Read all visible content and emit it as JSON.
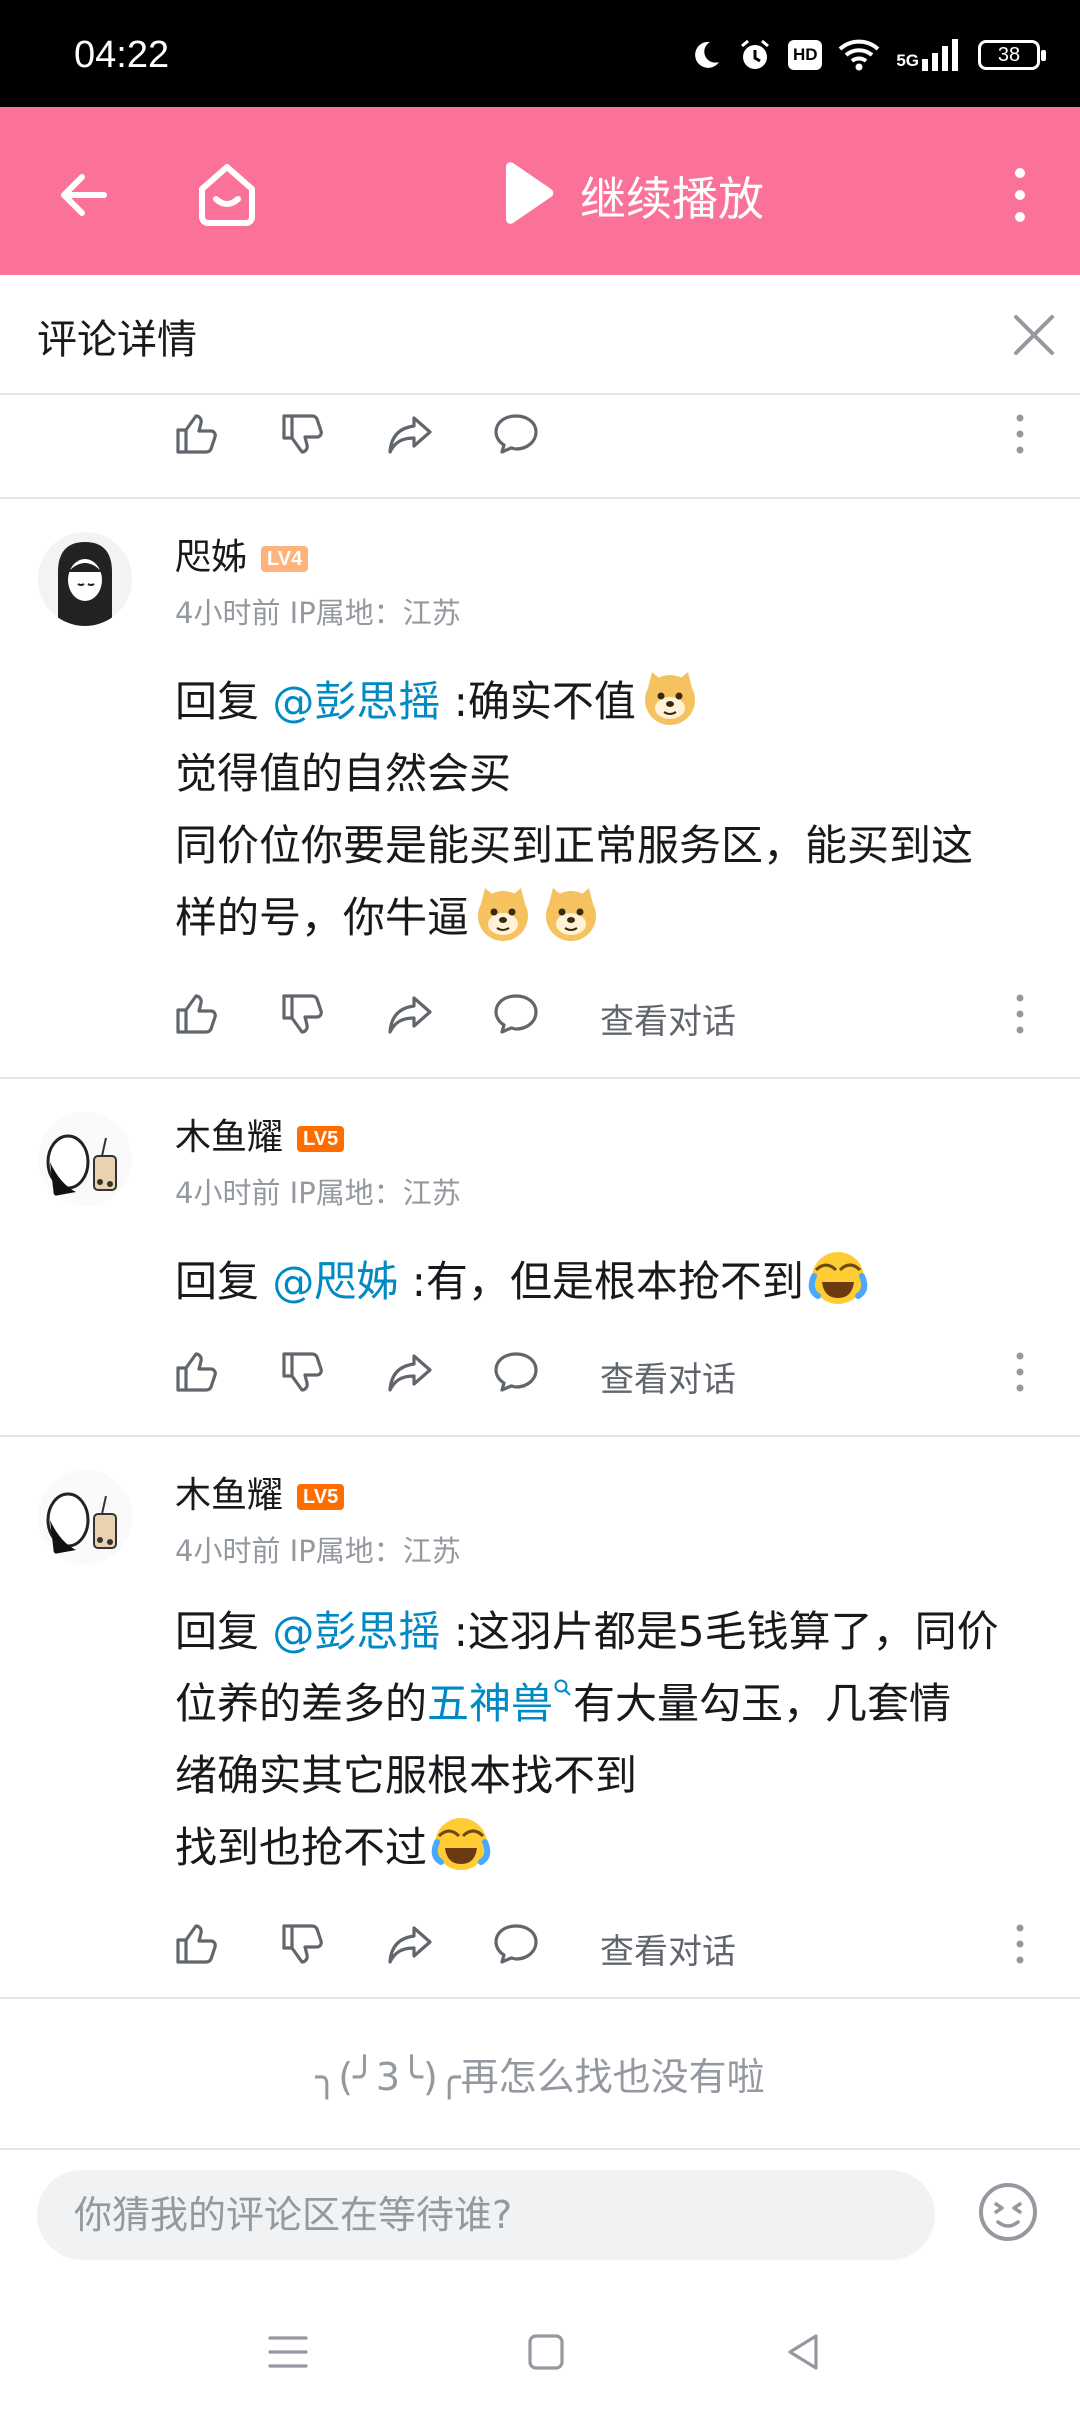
{
  "status_bar": {
    "time": "04:22",
    "network": "5G",
    "hd": "HD",
    "battery": "38"
  },
  "top_bar": {
    "continue_label": "继续播放"
  },
  "detail_header": {
    "title": "评论详情"
  },
  "comments": [
    {
      "username": "咫姊",
      "level": "LV4",
      "meta": "4小时前 IP属地：江苏",
      "lines": [
        {
          "prefix": "回复 ",
          "mention": "@彭思摇",
          "text": " :确实不值"
        },
        {
          "text": "觉得值的自然会买"
        },
        {
          "text": "同价位你要是能买到正常服务区，能买到这"
        },
        {
          "text": "样的号，你牛逼"
        }
      ],
      "view_conversation": "查看对话"
    },
    {
      "username": "木鱼耀",
      "level": "LV5",
      "meta": "4小时前 IP属地：江苏",
      "lines": [
        {
          "prefix": "回复 ",
          "mention": "@咫姊",
          "text": " :有，但是根本抢不到"
        }
      ],
      "view_conversation": "查看对话"
    },
    {
      "username": "木鱼耀",
      "level": "LV5",
      "meta": "4小时前 IP属地：江苏",
      "lines": [
        {
          "prefix": "回复 ",
          "mention": "@彭思摇",
          "text": " :这羽片都是5毛钱算了，同价"
        },
        {
          "pre": "位养的差多的",
          "link": "五神兽",
          "post": "有大量勾玉，几套情"
        },
        {
          "text": "绪确实其它服根本找不到"
        },
        {
          "text": "找到也抢不过"
        }
      ],
      "view_conversation": "查看对话"
    }
  ],
  "end_note": "╮(╯3╰)╭再怎么找也没有啦",
  "comment_input": {
    "placeholder": "你猜我的评论区在等待谁?"
  },
  "icons": {
    "back": "back-arrow-icon",
    "home": "home-icon",
    "play": "play-icon",
    "more": "more-vertical-icon",
    "close": "close-icon",
    "like": "thumbs-up-icon",
    "dislike": "thumbs-down-icon",
    "share": "share-icon",
    "reply": "comment-bubble-icon",
    "emoji": "emoji-icon"
  },
  "colors": {
    "brand_pink": "#fb7299",
    "mention_blue": "#008ac5",
    "lv4": "#ffb37c",
    "lv5": "#ff6c00"
  }
}
